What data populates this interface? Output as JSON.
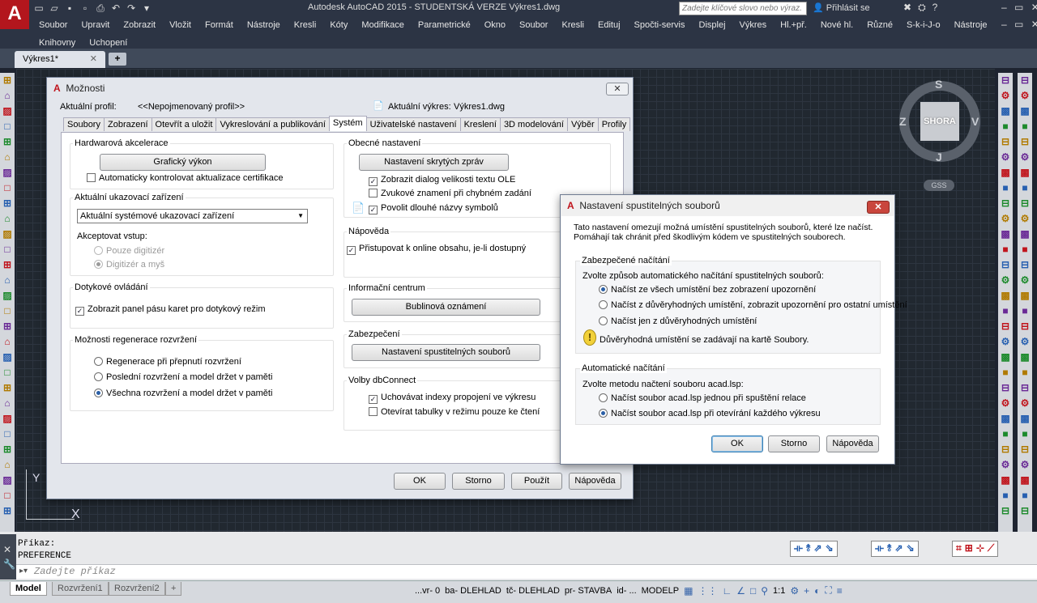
{
  "app": {
    "title": "Autodesk AutoCAD 2015 - STUDENTSKÁ VERZE   Výkres1.dwg",
    "search_placeholder": "Zadejte klíčové slovo nebo výraz.",
    "signin": "Přihlásit se",
    "app_button_letter": "A",
    "win_controls": "– ▭ ✕",
    "accent": "#b3161d"
  },
  "menu": [
    "Soubor",
    "Upravit",
    "Zobrazit",
    "Vložit",
    "Formát",
    "Nástroje",
    "Kresli",
    "Kóty",
    "Modifikace",
    "Parametrické",
    "Okno",
    "Soubor",
    "Kresli",
    "Edituj",
    "Spočti-servis",
    "Displej",
    "Výkres",
    "Hl.+př.",
    "Nové hl.",
    "Různé",
    "S-k-i-J-o",
    "Nástroje",
    "Knihovny",
    "Uchopení"
  ],
  "doc_tabs": {
    "active": "Výkres1*",
    "close": "✕",
    "new": "+"
  },
  "viewcube": {
    "face": "SHORA",
    "north": "S",
    "south": "J",
    "west": "Z",
    "east": "V",
    "wcs": "GSS"
  },
  "axes": {
    "x": "X",
    "y": "Y"
  },
  "options_dialog": {
    "title": "Možnosti",
    "profile_label": "Aktuální profil:",
    "profile_value": "<<Nepojmenovaný profil>>",
    "drawing_label": "Aktuální výkres:",
    "drawing_value": "Výkres1.dwg",
    "tabs": [
      "Soubory",
      "Zobrazení",
      "Otevřít a uložit",
      "Vykreslování a publikování",
      "Systém",
      "Uživatelské nastavení",
      "Kreslení",
      "3D modelování",
      "Výběr",
      "Profily"
    ],
    "active_tab": "Systém",
    "hw": {
      "title": "Hardwarová akcelerace",
      "button": "Grafický výkon",
      "check": "Automaticky kontrolovat aktualizace certifikace",
      "checked": false
    },
    "pointing": {
      "title": "Aktuální ukazovací zařízení",
      "select": "Aktuální systémové ukazovací zařízení",
      "accept": "Akceptovat vstup:",
      "opt1": "Pouze digitizér",
      "opt2": "Digitizér a myš"
    },
    "touch": {
      "title": "Dotykové ovládání",
      "check": "Zobrazit panel pásu karet pro dotykový režim",
      "checked": true
    },
    "regen": {
      "title": "Možnosti regenerace rozvržení",
      "opt1": "Regenerace při přepnutí rozvržení",
      "opt2": "Poslední rozvržení a model držet v paměti",
      "opt3": "Všechna rozvržení a model držet v paměti"
    },
    "general": {
      "title": "Obecné nastavení",
      "button": "Nastavení skrytých zpráv",
      "c1": "Zobrazit dialog velikosti textu OLE",
      "c2": "Zvukové znamení při chybném zadání",
      "c3": "Povolit dlouhé názvy symbolů"
    },
    "help": {
      "title": "Nápověda",
      "check": "Přistupovat k online obsahu, je-li dostupný"
    },
    "info": {
      "title": "Informační centrum",
      "button": "Bublinová oznámení"
    },
    "security": {
      "title": "Zabezpečení",
      "button": "Nastavení spustitelných souborů"
    },
    "dbconnect": {
      "title": "Volby dbConnect",
      "c1": "Uchovávat indexy propojení ve výkresu",
      "c2": "Otevírat tabulky v režimu pouze ke čtení"
    },
    "buttons": {
      "ok": "OK",
      "cancel": "Storno",
      "apply": "Použít",
      "help": "Nápověda"
    }
  },
  "sub_dialog": {
    "title": "Nastavení spustitelných souborů",
    "intro": "Tato nastavení omezují možná umístění spustitelných souborů, které lze načíst. Pomáhají tak chránit před škodlivým kódem ve spustitelných souborech.",
    "secure": {
      "title": "Zabezpečené načítání",
      "prompt": "Zvolte způsob automatického načítání spustitelných souborů:",
      "o1": "Načíst ze všech umístění bez zobrazení upozornění",
      "o2": "Načíst z důvěryhodných umístění, zobrazit upozornění pro ostatní umístění",
      "o3": "Načíst jen z důvěryhodných umístění",
      "note": "Důvěryhodná umístění se zadávají na kartě Soubory."
    },
    "auto": {
      "title": "Automatické načítání",
      "prompt": "Zvolte metodu načtení souboru acad.lsp:",
      "o1": "Načíst soubor acad.lsp jednou při spuštění relace",
      "o2": "Načíst soubor acad.lsp při otevírání každého výkresu"
    },
    "buttons": {
      "ok": "OK",
      "cancel": "Storno",
      "help": "Nápověda"
    }
  },
  "command": {
    "line1": "Příkaz:",
    "line2": "PREFERENCE",
    "placeholder": "Zadejte příkaz"
  },
  "layout_tabs": [
    "Model",
    "Rozvržení1",
    "Rozvržení2"
  ],
  "status": [
    "...vr- 0",
    "ba- DLEHLAD",
    "tč- DLEHLAD",
    "pr- STAVBA",
    "id- ...",
    "MODELP"
  ],
  "scale": "1:1"
}
